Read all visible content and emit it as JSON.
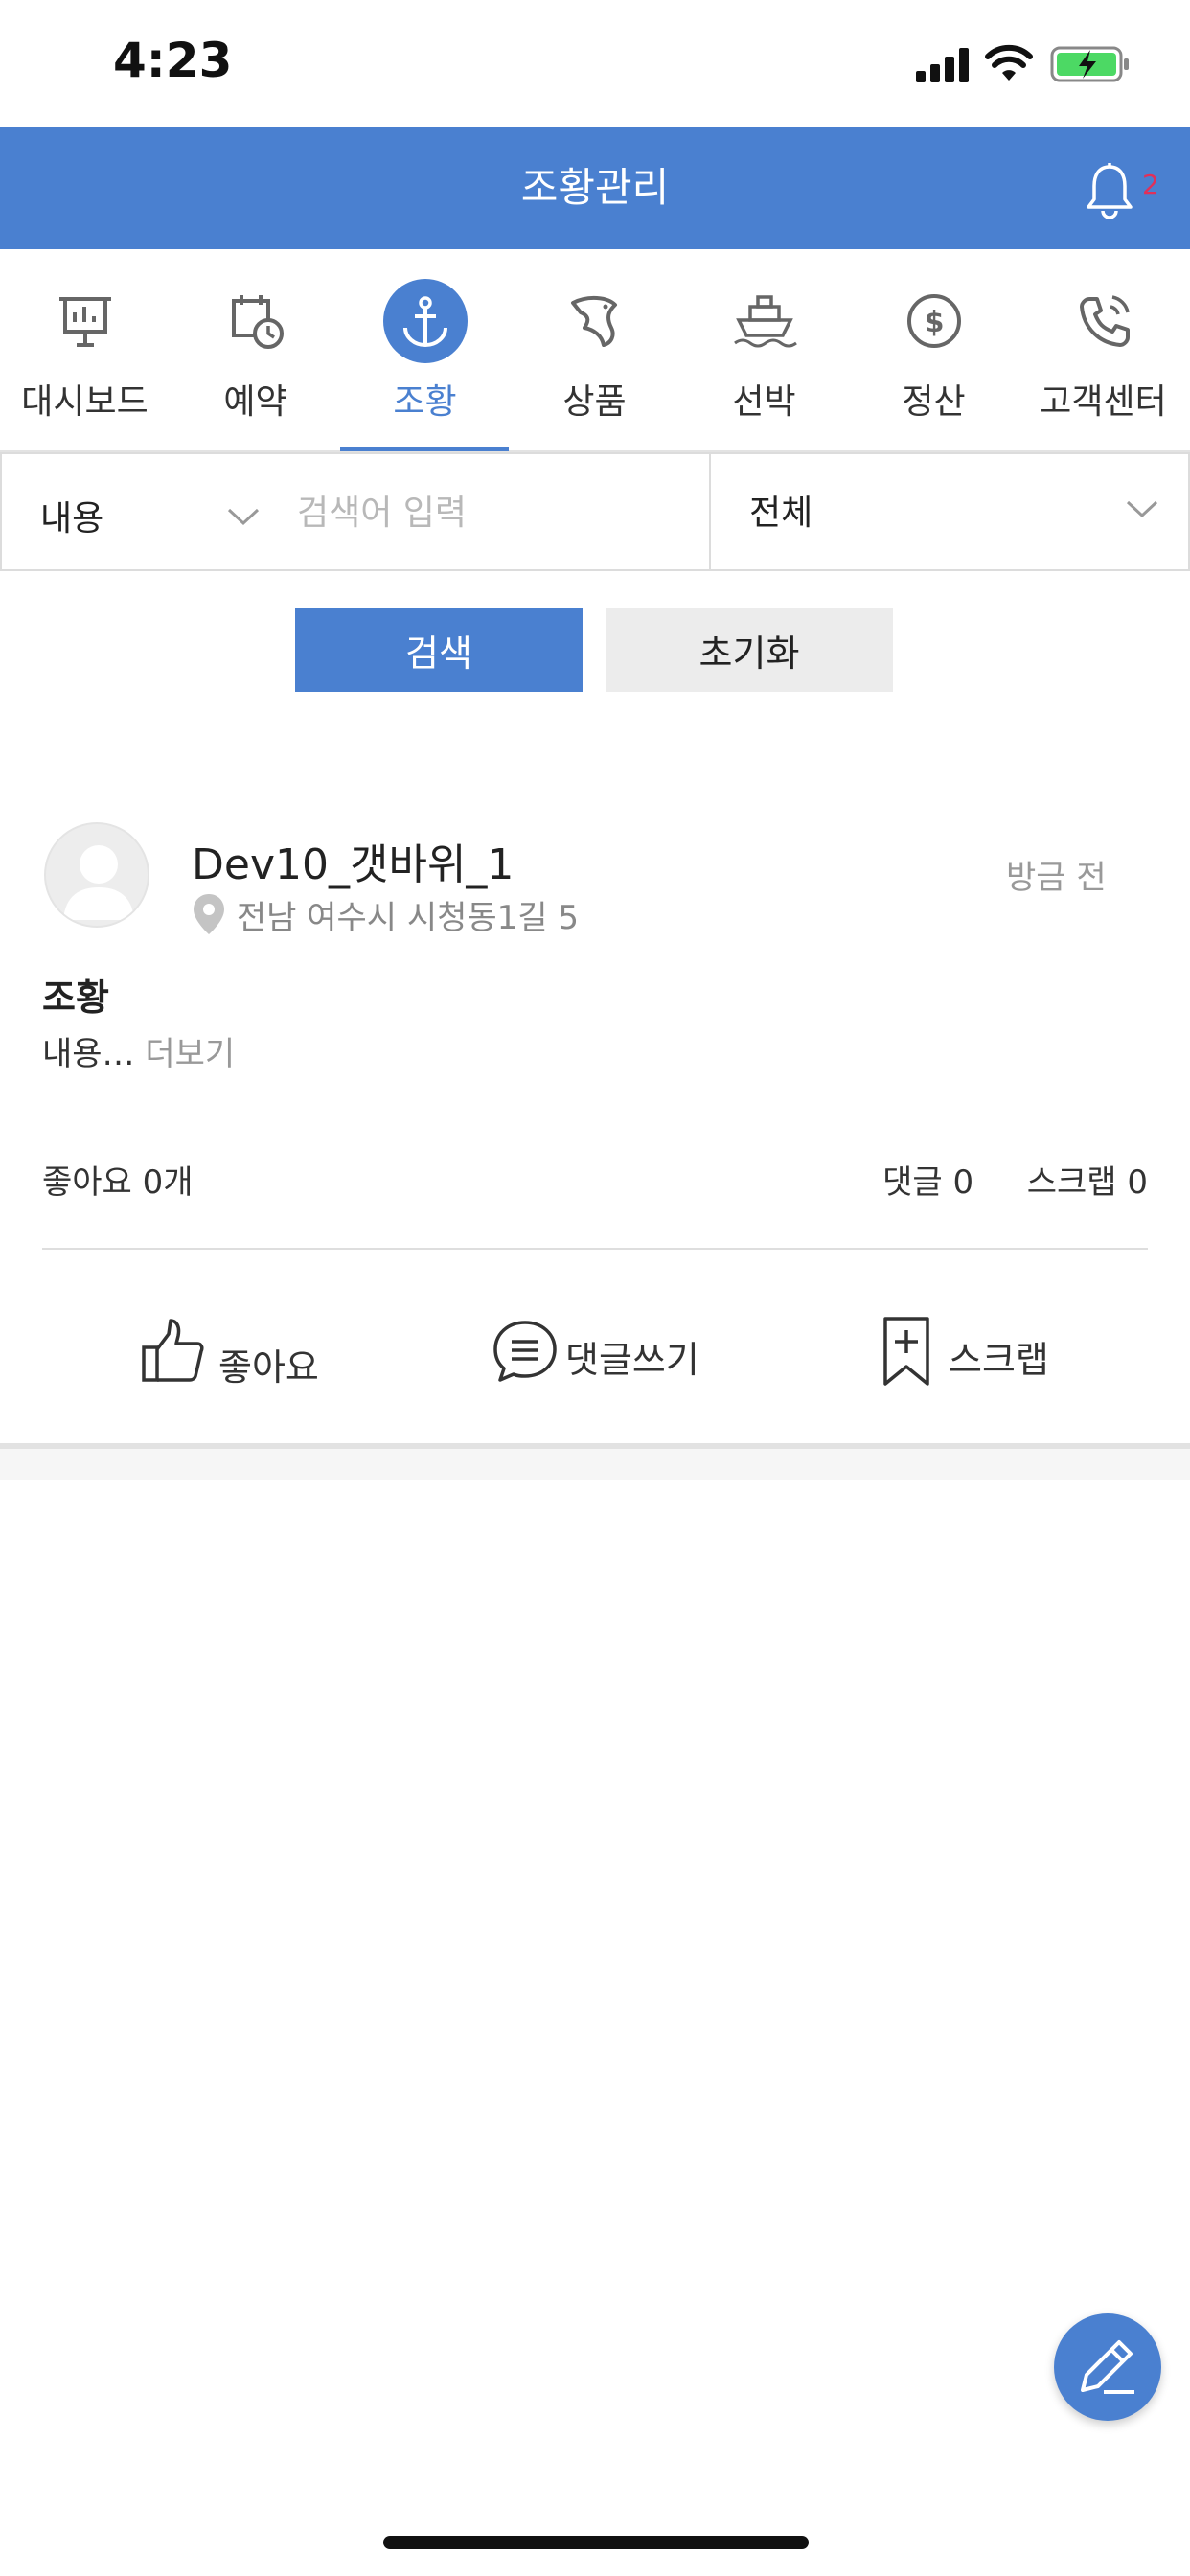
{
  "status_bar": {
    "time": "4:23"
  },
  "header": {
    "title": "조황관리",
    "badge_count": "2"
  },
  "tabs": [
    {
      "label": "대시보드",
      "icon": "presentation-board-icon"
    },
    {
      "label": "예약",
      "icon": "calendar-clock-icon"
    },
    {
      "label": "조황",
      "icon": "anchor-icon",
      "active": true
    },
    {
      "label": "상품",
      "icon": "fish-icon"
    },
    {
      "label": "선박",
      "icon": "ship-icon"
    },
    {
      "label": "정산",
      "icon": "dollar-coin-icon"
    },
    {
      "label": "고객센터",
      "icon": "phone-icon"
    }
  ],
  "search": {
    "field_select": "내용",
    "placeholder": "검색어 입력",
    "scope_select": "전체",
    "search_button": "검색",
    "reset_button": "초기화"
  },
  "post": {
    "author": "Dev10_갯바위_1",
    "location": "전남 여수시 시청동1길 5",
    "time": "방금 전",
    "category": "조황",
    "body": "내용…",
    "more": "더보기",
    "likes_stat": "좋아요 0개",
    "comments_stat": "댓글 0",
    "scraps_stat": "스크랩 0",
    "actions": {
      "like": "좋아요",
      "comment": "댓글쓰기",
      "scrap": "스크랩"
    }
  },
  "colors": {
    "accent": "#4A80D0",
    "badge": "#E0305A",
    "battery": "#4CD964"
  }
}
